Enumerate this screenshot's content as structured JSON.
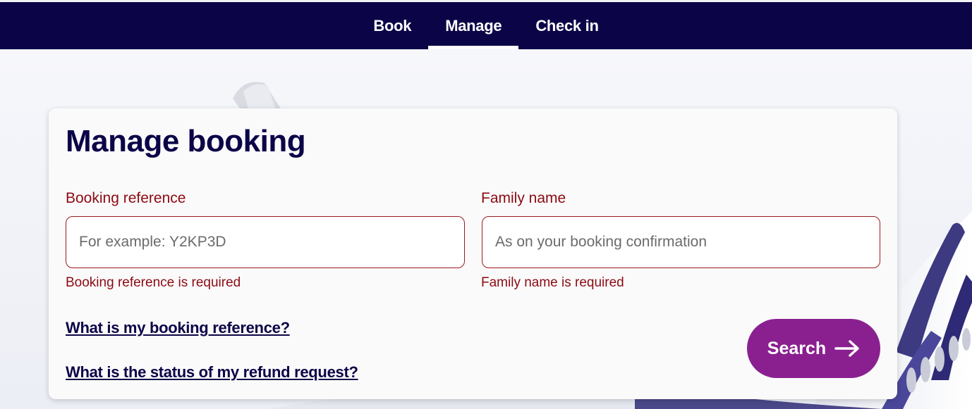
{
  "nav": {
    "tabs": [
      {
        "label": "Book"
      },
      {
        "label": "Manage"
      },
      {
        "label": "Check in"
      }
    ],
    "active_tab": "Manage"
  },
  "form": {
    "title": "Manage booking",
    "booking_reference": {
      "label": "Booking reference",
      "placeholder": "For example: Y2KP3D",
      "value": "",
      "error": "Booking reference is required"
    },
    "family_name": {
      "label": "Family name",
      "placeholder": "As on your booking confirmation",
      "value": "",
      "error": "Family name is required"
    },
    "links": {
      "booking_reference_help": "What is my booking reference?",
      "refund_status": "What is the status of my refund request?"
    },
    "search_button": {
      "label": "Search",
      "icon": "arrow-right-icon"
    }
  },
  "colors": {
    "nav_background": "#0b0548",
    "title": "#0b0548",
    "error": "#8b0a13",
    "button": "#8a2090"
  }
}
